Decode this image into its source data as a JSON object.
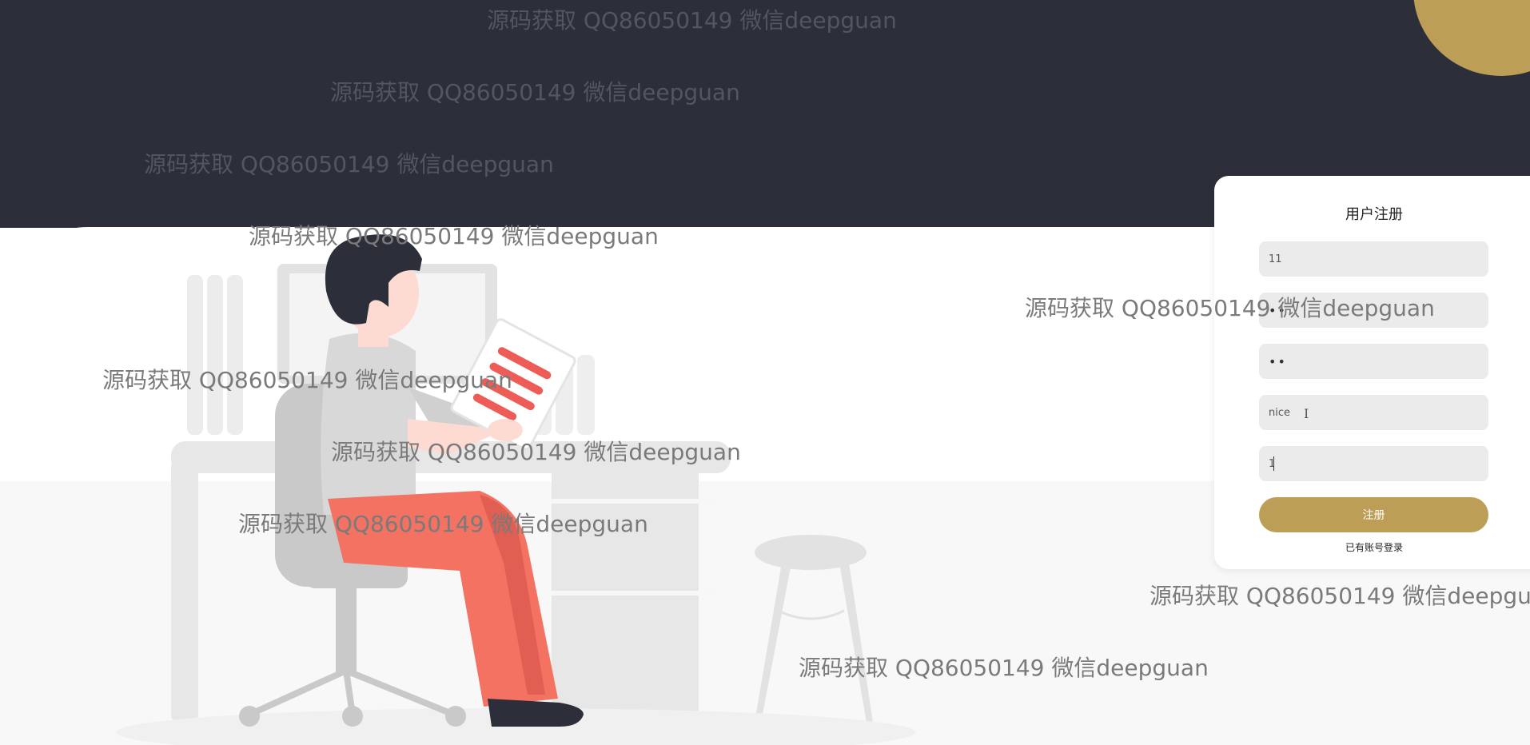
{
  "colors": {
    "top_band": "#2c2f3a",
    "accent": "#bd9e57",
    "field_bg": "#ebebeb",
    "pants": "#f37261",
    "paper_stripes": "#ee5c57"
  },
  "register": {
    "title": "用户注册",
    "fields": [
      {
        "value": "11"
      },
      {
        "value": "••"
      },
      {
        "value": "••"
      },
      {
        "value": "nice"
      },
      {
        "value": "1"
      }
    ],
    "submit_label": "注册",
    "login_link": "已有账号登录"
  },
  "watermarks": [
    {
      "text": "源码获取 QQ86050149 微信deepguan"
    },
    {
      "text": "源码获取 QQ86050149 微信deepguan"
    },
    {
      "text": "源码获取 QQ86050149 微信deepguan"
    },
    {
      "text": "源码获取 QQ86050149 微信deepguan"
    },
    {
      "text": "源码获取 QQ86050149 微信deepguan"
    },
    {
      "text": "源码获取 QQ86050149 微信deepguan"
    },
    {
      "text": "源码获取 QQ86050149 微信deepguan"
    },
    {
      "text": "源码获取 QQ86050149 微信deepguan"
    },
    {
      "text": "源码获取 QQ86050149 微信deepguan"
    },
    {
      "text": "源码获取 QQ86050149 微信deepguan"
    }
  ]
}
